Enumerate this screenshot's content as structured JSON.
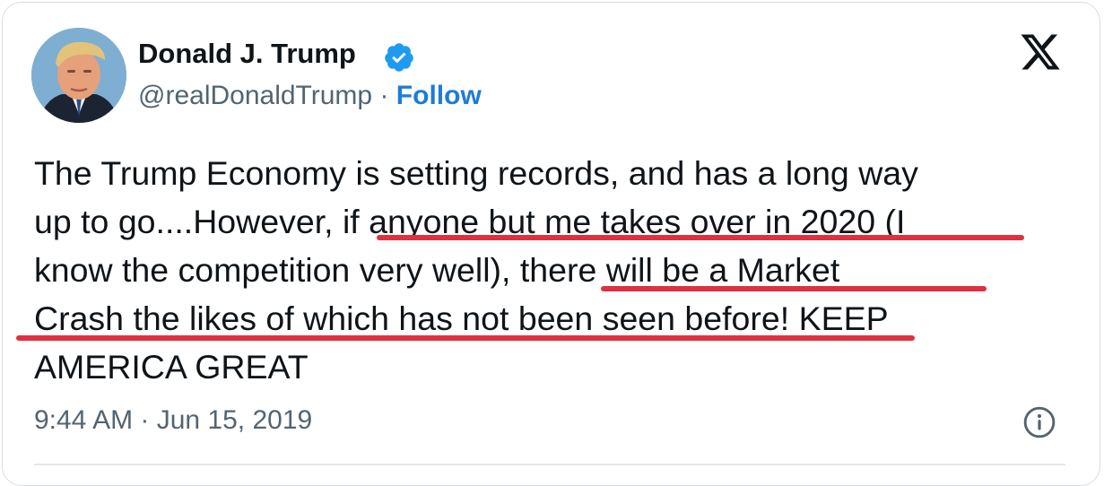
{
  "author": {
    "display_name": "Donald J. Trump",
    "handle": "@realDonaldTrump",
    "separator": "·",
    "follow_label": "Follow",
    "verified_icon": "verified-badge-icon",
    "colors": {
      "verified": "#1d9bf0",
      "follow": "#1d7dd6"
    }
  },
  "brand": {
    "logo_icon": "x-logo-icon"
  },
  "tweet": {
    "lines": [
      "The Trump Economy is setting records, and has a long way",
      "up to go....However, if anyone but me takes over in 2020 (I",
      "know the competition very well), there will be a Market",
      "Crash the likes of which has not been seen before! KEEP",
      "AMERICA GREAT"
    ],
    "highlight_color": "#e0303f"
  },
  "meta": {
    "timestamp": "9:44 AM · Jun 15, 2019",
    "info_icon": "info-icon"
  }
}
